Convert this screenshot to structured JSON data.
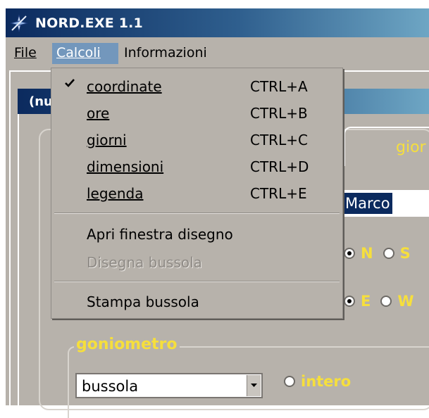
{
  "window": {
    "title": "NORD.EXE 1.1"
  },
  "menubar": {
    "items": [
      {
        "label": "File"
      },
      {
        "label": "Calcoli"
      },
      {
        "label": "Informazioni"
      }
    ]
  },
  "menu_calcoli": {
    "items": [
      {
        "label": "coordinate",
        "shortcut": "CTRL+A",
        "checked": true
      },
      {
        "label": "ore",
        "shortcut": "CTRL+B"
      },
      {
        "label": "giorni",
        "shortcut": "CTRL+C"
      },
      {
        "label": "dimensioni",
        "shortcut": "CTRL+D"
      },
      {
        "label": "legenda",
        "shortcut": "CTRL+E"
      },
      {
        "label": "Apri finestra disegno"
      },
      {
        "label": "Disegna bussola",
        "disabled": true
      },
      {
        "label": "Stampa bussola"
      }
    ]
  },
  "child_window": {
    "title_visible": "(nu"
  },
  "tabs": {
    "giorni_partial": "gior"
  },
  "form": {
    "name_value": "Marco",
    "lat_options": [
      "N",
      "S"
    ],
    "lon_options": [
      "E",
      "W"
    ],
    "goniometro": {
      "legend": "goniometro",
      "select_value": "bussola",
      "option": "intero"
    }
  },
  "colors": {
    "accent_label": "#f6df3c",
    "menu_highlight": "#7397bc",
    "face": "#b7b2ab"
  }
}
